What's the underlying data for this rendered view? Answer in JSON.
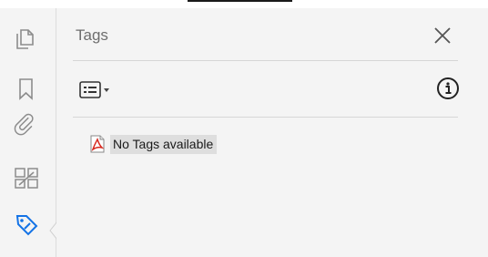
{
  "panel": {
    "title": "Tags",
    "close_icon": "close-icon",
    "options_icon": "tag-options-icon",
    "info_icon": "info-icon"
  },
  "rail": {
    "items": [
      {
        "name": "page-thumbnails-icon",
        "selected": false
      },
      {
        "name": "bookmark-icon",
        "selected": false
      },
      {
        "name": "attachment-icon",
        "selected": false
      },
      {
        "name": "layers-icon",
        "selected": false
      },
      {
        "name": "tag-icon",
        "selected": true
      }
    ]
  },
  "tags": {
    "empty_label": "No Tags available",
    "icon": "pdf-file-icon"
  },
  "colors": {
    "accent": "#1473e6",
    "panel_bg": "#f4f4f4",
    "pdf_red": "#d7281e"
  }
}
